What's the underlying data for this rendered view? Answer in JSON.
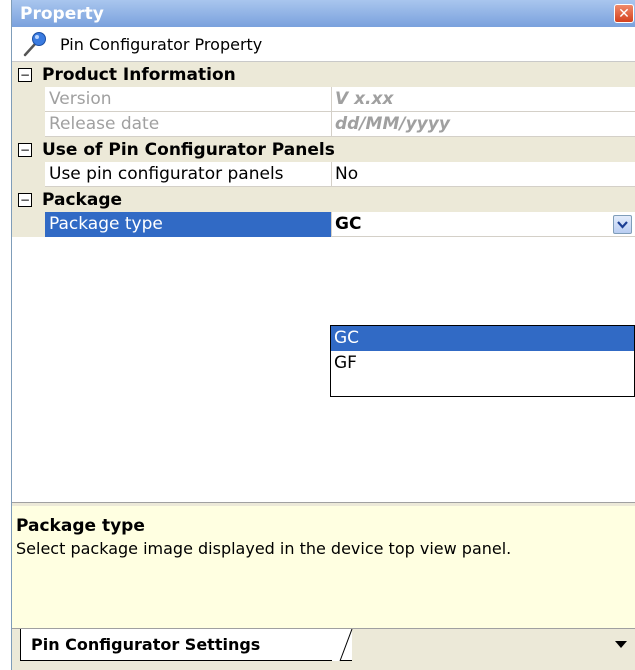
{
  "window": {
    "title": "Property",
    "close_glyph": "✕"
  },
  "subheader": {
    "icon": "pin-icon",
    "label": "Pin Configurator Property"
  },
  "grid": {
    "categories": [
      {
        "name": "Product Information",
        "toggle": "−",
        "items": [
          {
            "name": "Version",
            "value": "V x.xx"
          },
          {
            "name": "Release date",
            "value": "dd/MM/yyyy"
          }
        ]
      },
      {
        "name": "Use of Pin Configurator Panels",
        "toggle": "−",
        "items": [
          {
            "name": "Use pin configurator panels",
            "value": "No"
          }
        ]
      },
      {
        "name": "Package",
        "toggle": "−",
        "items": [
          {
            "name": "Package type",
            "value": "GC"
          }
        ]
      }
    ]
  },
  "dropdown": {
    "options": [
      "GC",
      "GF"
    ],
    "selected": "GC"
  },
  "description": {
    "title": "Package type",
    "text": "Select package image displayed in the device top view panel."
  },
  "tabs": {
    "active_label": "Pin Configurator Settings"
  },
  "colors": {
    "selection": "#316ac5",
    "category_bg": "#ece9d8",
    "description_bg": "#ffffe1"
  }
}
